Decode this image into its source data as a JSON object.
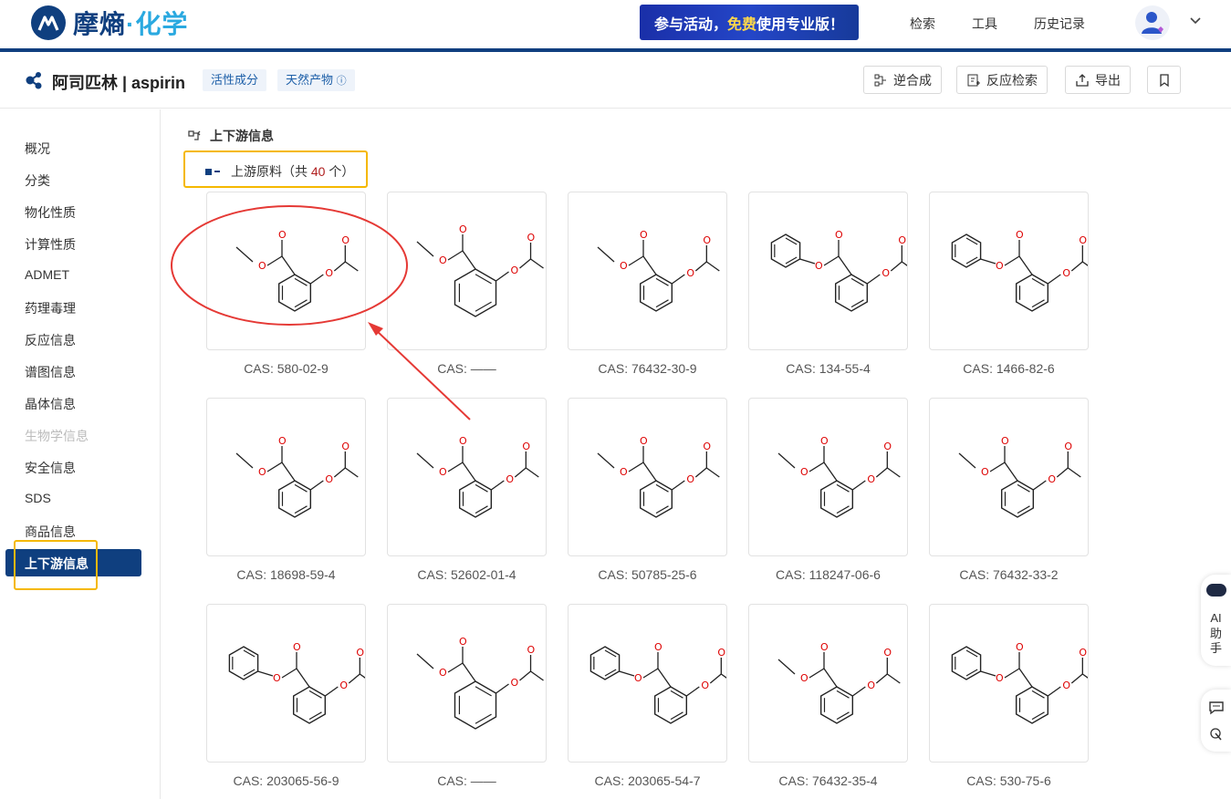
{
  "brand": {
    "name_main": "摩熵",
    "dot": "·",
    "name_accent": "化学"
  },
  "promo": {
    "pre": "参与活动，",
    "highlight": "免费",
    "post": "使用专业版！"
  },
  "nav": [
    "检索",
    "工具",
    "历史记录"
  ],
  "compound": {
    "title": "阿司匹林 | aspirin",
    "tags": [
      "活性成分",
      "天然产物"
    ]
  },
  "toolbar": [
    "逆合成",
    "反应检索",
    "导出"
  ],
  "sidebar": {
    "items": [
      "概况",
      "分类",
      "物化性质",
      "计算性质",
      "ADMET",
      "药理毒理",
      "反应信息",
      "谱图信息",
      "晶体信息",
      "生物学信息",
      "安全信息",
      "SDS",
      "商品信息"
    ],
    "disabled": [
      "生物学信息"
    ],
    "active": "上下游信息"
  },
  "section": {
    "title": "上下游信息",
    "sub_pre": "上游原料（共",
    "count": "40",
    "sub_post": "个）"
  },
  "cas_prefix": "CAS: ",
  "cards": [
    "580-02-9",
    "——",
    "76432-30-9",
    "134-55-4",
    "1466-82-6",
    "18698-59-4",
    "52602-01-4",
    "50785-25-6",
    "118247-06-6",
    "76432-33-2",
    "203065-56-9",
    "——",
    "203065-54-7",
    "76432-35-4",
    "530-75-6"
  ],
  "assistant": {
    "label": [
      "AI",
      "助",
      "手"
    ]
  },
  "colors": {
    "brand": "#0f3f7f",
    "accent": "#2aa9e0",
    "highlight_box": "#f5b800",
    "annotation": "#e53935"
  }
}
